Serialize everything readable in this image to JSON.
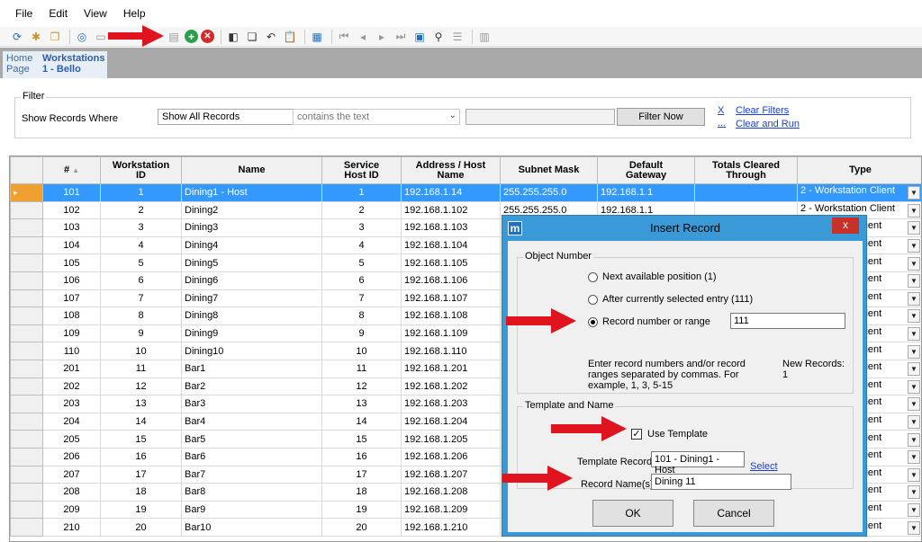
{
  "menu": {
    "file": "File",
    "edit": "Edit",
    "view": "View",
    "help": "Help"
  },
  "tabs": [
    {
      "line1": "Home",
      "line2": "Page"
    },
    {
      "line1": "Workstations",
      "line2": "1 - Bello"
    }
  ],
  "filter": {
    "legend": "Filter",
    "show_where": "Show Records Where",
    "show_all": "Show All Records",
    "contains": "contains the text",
    "filter_now": "Filter Now",
    "x": "X",
    "dots": "...",
    "clear_filters": "Clear Filters",
    "clear_run": "Clear and Run"
  },
  "grid": {
    "headers": {
      "num": "#",
      "ws_id_1": "Workstation",
      "ws_id_2": "ID",
      "name": "Name",
      "svc_1": "Service",
      "svc_2": "Host ID",
      "addr_1": "Address / Host",
      "addr_2": "Name",
      "subnet": "Subnet Mask",
      "gw_1": "Default",
      "gw_2": "Gateway",
      "totals_1": "Totals Cleared",
      "totals_2": "Through",
      "type": "Type"
    },
    "rows": [
      {
        "num": "101",
        "id": "1",
        "name": "Dining1 - Host",
        "svc": "1",
        "addr": "192.168.1.14",
        "subnet": "255.255.255.0",
        "gw": "192.168.1.1",
        "type": "2 - Workstation Client"
      },
      {
        "num": "102",
        "id": "2",
        "name": "Dining2",
        "svc": "2",
        "addr": "192.168.1.102",
        "subnet": "255.255.255.0",
        "gw": "192.168.1.1",
        "type": "2 - Workstation Client"
      },
      {
        "num": "103",
        "id": "3",
        "name": "Dining3",
        "svc": "3",
        "addr": "192.168.1.103",
        "subnet": "",
        "gw": "",
        "type": "lient"
      },
      {
        "num": "104",
        "id": "4",
        "name": "Dining4",
        "svc": "4",
        "addr": "192.168.1.104",
        "subnet": "",
        "gw": "",
        "type": "lient"
      },
      {
        "num": "105",
        "id": "5",
        "name": "Dining5",
        "svc": "5",
        "addr": "192.168.1.105",
        "subnet": "",
        "gw": "",
        "type": "lient"
      },
      {
        "num": "106",
        "id": "6",
        "name": "Dining6",
        "svc": "6",
        "addr": "192.168.1.106",
        "subnet": "",
        "gw": "",
        "type": "lient"
      },
      {
        "num": "107",
        "id": "7",
        "name": "Dining7",
        "svc": "7",
        "addr": "192.168.1.107",
        "subnet": "",
        "gw": "",
        "type": "lient"
      },
      {
        "num": "108",
        "id": "8",
        "name": "Dining8",
        "svc": "8",
        "addr": "192.168.1.108",
        "subnet": "",
        "gw": "",
        "type": "lient"
      },
      {
        "num": "109",
        "id": "9",
        "name": "Dining9",
        "svc": "9",
        "addr": "192.168.1.109",
        "subnet": "",
        "gw": "",
        "type": "lient"
      },
      {
        "num": "110",
        "id": "10",
        "name": "Dining10",
        "svc": "10",
        "addr": "192.168.1.110",
        "subnet": "",
        "gw": "",
        "type": "lient"
      },
      {
        "num": "201",
        "id": "11",
        "name": "Bar1",
        "svc": "11",
        "addr": "192.168.1.201",
        "subnet": "",
        "gw": "",
        "type": "lient"
      },
      {
        "num": "202",
        "id": "12",
        "name": "Bar2",
        "svc": "12",
        "addr": "192.168.1.202",
        "subnet": "",
        "gw": "",
        "type": "lient"
      },
      {
        "num": "203",
        "id": "13",
        "name": "Bar3",
        "svc": "13",
        "addr": "192.168.1.203",
        "subnet": "",
        "gw": "",
        "type": "lient"
      },
      {
        "num": "204",
        "id": "14",
        "name": "Bar4",
        "svc": "14",
        "addr": "192.168.1.204",
        "subnet": "",
        "gw": "",
        "type": "lient"
      },
      {
        "num": "205",
        "id": "15",
        "name": "Bar5",
        "svc": "15",
        "addr": "192.168.1.205",
        "subnet": "",
        "gw": "",
        "type": "lient"
      },
      {
        "num": "206",
        "id": "16",
        "name": "Bar6",
        "svc": "16",
        "addr": "192.168.1.206",
        "subnet": "",
        "gw": "",
        "type": "lient"
      },
      {
        "num": "207",
        "id": "17",
        "name": "Bar7",
        "svc": "17",
        "addr": "192.168.1.207",
        "subnet": "",
        "gw": "",
        "type": "lient"
      },
      {
        "num": "208",
        "id": "18",
        "name": "Bar8",
        "svc": "18",
        "addr": "192.168.1.208",
        "subnet": "",
        "gw": "",
        "type": "lient"
      },
      {
        "num": "209",
        "id": "19",
        "name": "Bar9",
        "svc": "19",
        "addr": "192.168.1.209",
        "subnet": "",
        "gw": "",
        "type": "lient"
      },
      {
        "num": "210",
        "id": "20",
        "name": "Bar10",
        "svc": "20",
        "addr": "192.168.1.210",
        "subnet": "",
        "gw": "",
        "type": "lient"
      }
    ]
  },
  "dialog": {
    "icon": "m",
    "title": "Insert Record",
    "close": "x",
    "object_number": "Object Number",
    "opt_next": "Next available position (1)",
    "opt_after": "After currently selected entry (111)",
    "opt_range": "Record number or range",
    "range_value": "111",
    "help": "Enter record numbers and/or record ranges separated by commas. For example, 1, 3, 5-15",
    "new_records": "New Records: 1",
    "template_and_name": "Template and Name",
    "use_template": "Use Template",
    "template_record_label": "Template Record",
    "template_record_value": "101 - Dining1 - Host",
    "select": "Select",
    "record_names_label": "Record Name(s)",
    "record_names_value": "Dining 11",
    "ok": "OK",
    "cancel": "Cancel"
  },
  "colors": {
    "selection": "#3399ff",
    "arrow": "#e0141e",
    "dialog_frame": "#3a9ad8"
  },
  "icons": [
    "refresh-icon",
    "wand-icon",
    "copy-icon",
    "record-icon",
    "comment-icon",
    "add-icon",
    "delete-icon",
    "first-icon",
    "prev-icon",
    "next-icon",
    "last-icon",
    "calendar-icon",
    "binoculars-icon",
    "list-icon"
  ]
}
